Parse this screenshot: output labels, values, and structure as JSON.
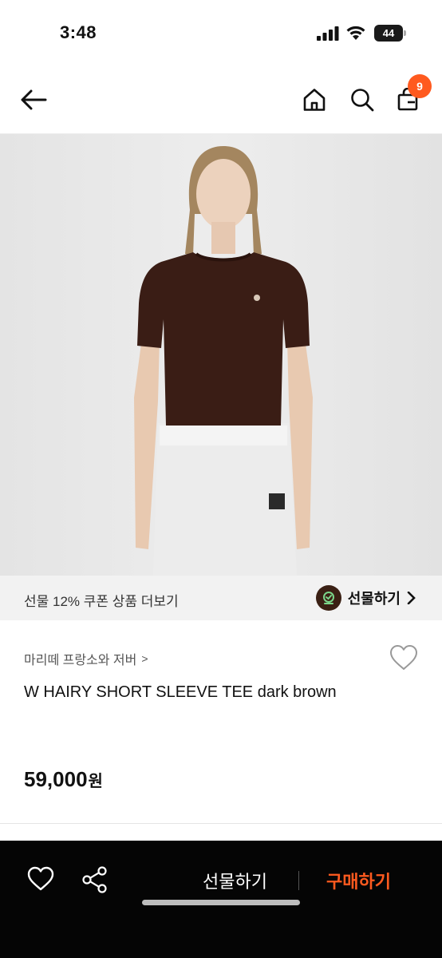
{
  "status": {
    "time": "3:48",
    "battery": "44"
  },
  "nav": {
    "cart_count": "9",
    "icons": [
      "back-arrow-icon",
      "home-icon",
      "search-icon",
      "shopping-bag-icon"
    ]
  },
  "coupon": {
    "text": "선물 12% 쿠폰 상품 더보기",
    "gift_label": "선물하기"
  },
  "product": {
    "brand": "마리떼 프랑소와 저버",
    "brand_chevron": ">",
    "title": "W HAIRY SHORT SLEEVE TEE dark brown",
    "price": "59,000",
    "price_unit": "원"
  },
  "bottom": {
    "gift_label": "선물하기",
    "buy_label": "구매하기"
  },
  "colors": {
    "accent": "#ff5a1f",
    "bottom_bar": "#050505",
    "sweater": "#3a1d15"
  }
}
